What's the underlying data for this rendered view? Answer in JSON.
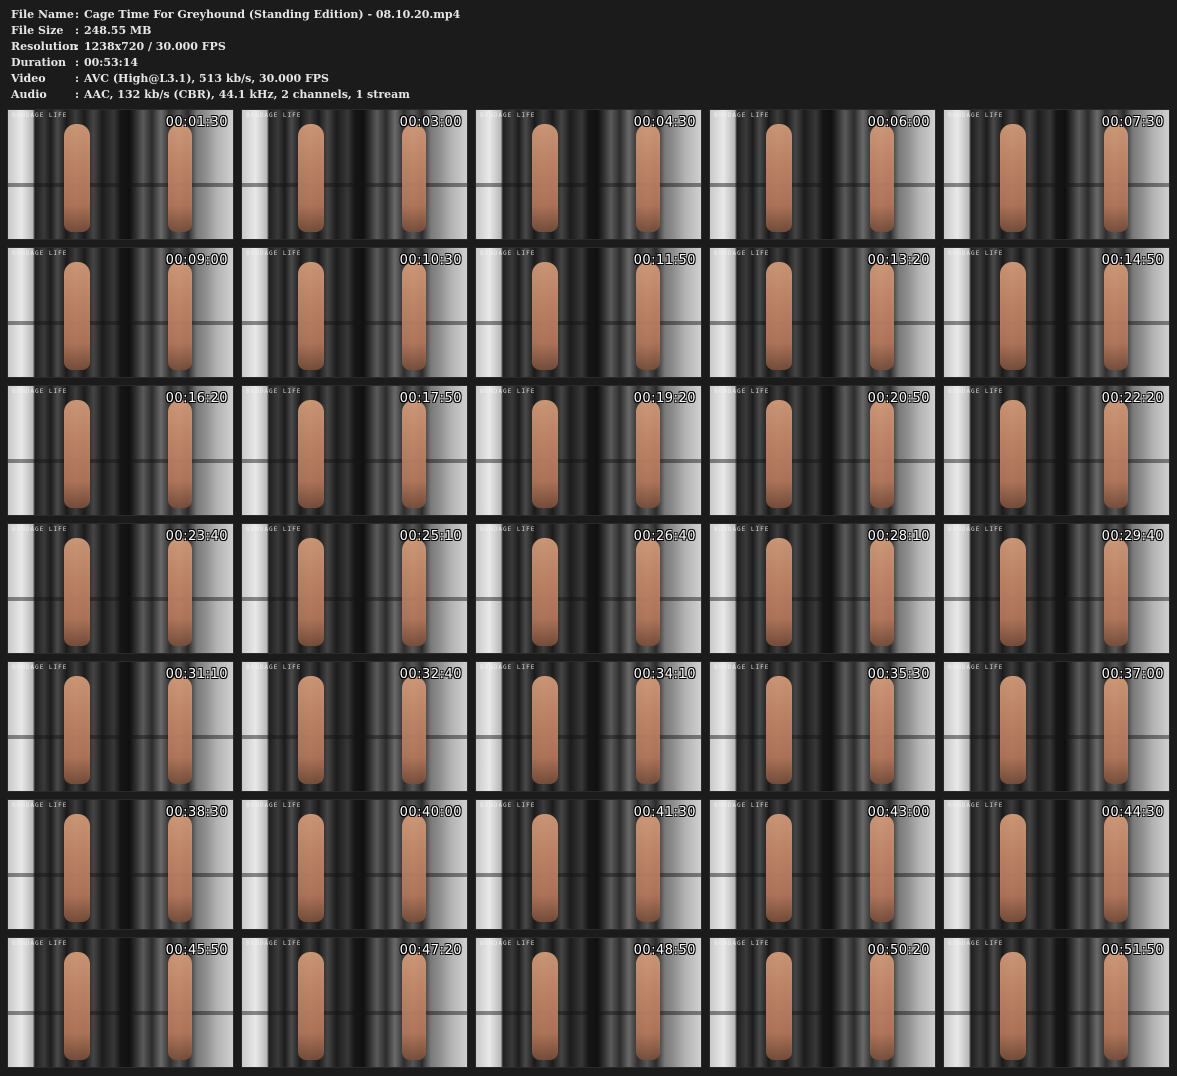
{
  "info": [
    {
      "label": "File Name",
      "sep": ":",
      "value": "Cage Time For Greyhound (Standing Edition) - 08.10.20.mp4"
    },
    {
      "label": "File Size",
      "sep": ":",
      "value": "248.55 MB"
    },
    {
      "label": "Resolution",
      "sep": ":",
      "value": "1238x720 / 30.000 FPS"
    },
    {
      "label": "Duration",
      "sep": ":",
      "value": "00:53:14"
    },
    {
      "label": "Video",
      "sep": ":",
      "value": "AVC (High@L3.1), 513 kb/s, 30.000 FPS"
    },
    {
      "label": "Audio",
      "sep": ":",
      "value": "AAC, 132 kb/s (CBR), 44.1 kHz, 2 channels, 1 stream"
    }
  ],
  "watermark": "BONDAGE LIFE",
  "thumbnails": [
    "00:01:30",
    "00:03:00",
    "00:04:30",
    "00:06:00",
    "00:07:30",
    "00:09:00",
    "00:10:30",
    "00:11:50",
    "00:13:20",
    "00:14:50",
    "00:16:20",
    "00:17:50",
    "00:19:20",
    "00:20:50",
    "00:22:20",
    "00:23:40",
    "00:25:10",
    "00:26:40",
    "00:28:10",
    "00:29:40",
    "00:31:10",
    "00:32:40",
    "00:34:10",
    "00:35:30",
    "00:37:00",
    "00:38:30",
    "00:40:00",
    "00:41:30",
    "00:43:00",
    "00:44:30",
    "00:45:50",
    "00:47:20",
    "00:48:50",
    "00:50:20",
    "00:51:50"
  ]
}
